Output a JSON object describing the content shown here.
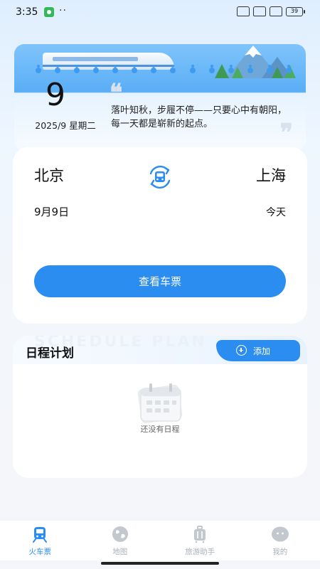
{
  "status_bar": {
    "time": "3:35",
    "dots": "··",
    "battery": "39"
  },
  "calendar": {
    "day": "9",
    "date_line": "2025/9 星期二",
    "quote": "落叶知秋，步履不停——只要心中有朝阳，每一天都是崭新的起点。",
    "quote_open_mark": "❝",
    "quote_close_mark": "❞"
  },
  "booking": {
    "from_city": "北京",
    "to_city": "上海",
    "date": "9月9日",
    "date_hint": "今天",
    "query_button": "查看车票",
    "swap_icon": "train-swap-icon"
  },
  "schedule": {
    "title": "日程计划",
    "watermark": "SCHEDULE PLAN",
    "add_button": "添加",
    "empty_text": "还没有日程",
    "empty_icon": "calendar-icon"
  },
  "tabbar": {
    "tabs": [
      {
        "label": "火车票",
        "icon": "train-icon",
        "active": true
      },
      {
        "label": "地图",
        "icon": "globe-icon",
        "active": false
      },
      {
        "label": "旅游助手",
        "icon": "luggage-icon",
        "active": false
      },
      {
        "label": "我的",
        "icon": "face-icon",
        "active": false
      }
    ]
  },
  "colors": {
    "accent": "#2c8df0",
    "inactive_tab": "#aab1ba",
    "background": "#f4f6f9"
  }
}
